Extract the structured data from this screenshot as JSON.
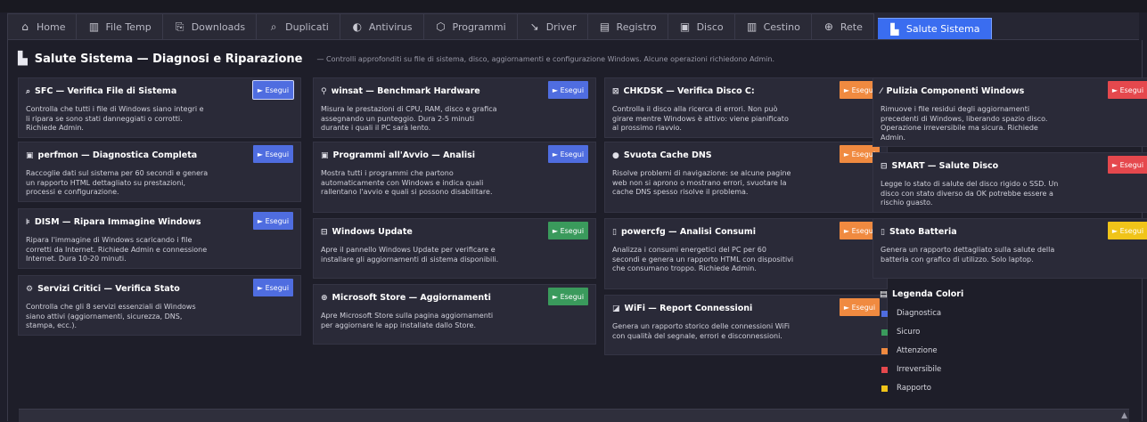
{
  "tabs": [
    {
      "icon": "⌂",
      "label": "Home"
    },
    {
      "icon": "▥",
      "label": "File Temp"
    },
    {
      "icon": "⎘",
      "label": "Downloads"
    },
    {
      "icon": "⌕",
      "label": "Duplicati"
    },
    {
      "icon": "◐",
      "label": "Antivirus"
    },
    {
      "icon": "⬡",
      "label": "Programmi"
    },
    {
      "icon": "↘",
      "label": "Driver"
    },
    {
      "icon": "▤",
      "label": "Registro"
    },
    {
      "icon": "▣",
      "label": "Disco"
    },
    {
      "icon": "▥",
      "label": "Cestino"
    },
    {
      "icon": "⊕",
      "label": "Rete"
    },
    {
      "icon": "▙",
      "label": "Salute Sistema"
    }
  ],
  "header": {
    "icon": "▙",
    "title": "Salute Sistema — Diagnosi e Riparazione",
    "subtitle": "— Controlli approfonditi su file di sistema, disco, aggiornamenti e configurazione Windows. Alcune operazioni richiedono Admin."
  },
  "columns": [
    [
      {
        "icon": "⌕",
        "title": "SFC — Verifica File di Sistema",
        "desc": "Controlla che tutti i file di Windows siano integri e li ripara se sono stati danneggiati o corrotti. Richiede Admin.",
        "button": "► Esegui",
        "color": "blue"
      },
      {
        "icon": "▣",
        "title": "perfmon — Diagnostica Completa",
        "desc": "Raccoglie dati sul sistema per 60 secondi e genera un rapporto HTML dettagliato su prestazioni, processi e configurazione.",
        "button": "► Esegui",
        "color": "blue"
      },
      {
        "icon": "⊧",
        "title": "DISM — Ripara Immagine Windows",
        "desc": "Ripara l'immagine di Windows scaricando i file corretti da Internet. Richiede Admin e connessione Internet. Dura 10-20 minuti.",
        "button": "► Esegui",
        "color": "blue"
      },
      {
        "icon": "⚙",
        "title": "Servizi Critici — Verifica Stato",
        "desc": "Controlla che gli 8 servizi essenziali di Windows siano attivi (aggiornamenti, sicurezza, DNS, stampa, ecc.).",
        "button": "► Esegui",
        "color": "blue"
      }
    ],
    [
      {
        "icon": "⚲",
        "title": "winsat — Benchmark Hardware",
        "desc": "Misura le prestazioni di CPU, RAM, disco e grafica assegnando un punteggio. Dura 2-5 minuti durante i quali il PC sarà lento.",
        "button": "► Esegui",
        "color": "blue"
      },
      {
        "icon": "▣",
        "title": "Programmi all'Avvio — Analisi",
        "desc": "Mostra tutti i programmi che partono automaticamente con Windows e indica quali rallentano l'avvio e quali si possono disabilitare.",
        "button": "► Esegui",
        "color": "blue"
      },
      {
        "icon": "⊟",
        "title": "Windows Update",
        "desc": "Apre il pannello Windows Update per verificare e installare gli aggiornamenti di sistema disponibili.",
        "button": "► Esegui",
        "color": "green"
      },
      {
        "icon": "⊕",
        "title": "Microsoft Store — Aggiornamenti",
        "desc": "Apre Microsoft Store sulla pagina aggiornamenti per aggiornare le app installate dallo Store.",
        "button": "► Esegui",
        "color": "green"
      }
    ],
    [
      {
        "icon": "⊠",
        "title": "CHKDSK — Verifica Disco C:",
        "desc": "Controlla il disco alla ricerca di errori. Non può girare mentre Windows è attivo: viene pianificato al prossimo riavvio.",
        "button": "► Esegui",
        "color": "orange"
      },
      {
        "icon": "●",
        "title": "Svuota Cache DNS",
        "desc": "Risolve problemi di navigazione: se alcune pagine web non si aprono o mostrano errori, svuotare la cache DNS spesso risolve il problema.",
        "button": "► Esegui",
        "color": "orange"
      },
      {
        "icon": "▯",
        "title": "powercfg — Analisi Consumi",
        "desc": "Analizza i consumi energetici del PC per 60 secondi e genera un rapporto HTML con dispositivi che consumano troppo. Richiede Admin.",
        "button": "► Esegui",
        "color": "orange"
      },
      {
        "icon": "◪",
        "title": "WiFi — Report Connessioni",
        "desc": "Genera un rapporto storico delle connessioni WiFi con qualità del segnale, errori e disconnessioni.",
        "button": "► Esegui",
        "color": "orange"
      }
    ],
    [
      {
        "icon": "⁄",
        "title": "Pulizia Componenti Windows",
        "desc": "Rimuove i file residui degli aggiornamenti precedenti di Windows, liberando spazio disco. Operazione irreversibile ma sicura. Richiede Admin.",
        "button": "► Esegui",
        "color": "red"
      },
      {
        "icon": "⊟",
        "title": "SMART — Salute Disco",
        "desc": "Legge lo stato di salute del disco rigido o SSD. Un disco con stato diverso da OK potrebbe essere a rischio guasto.",
        "button": "► Esegui",
        "color": "red"
      },
      {
        "icon": "▯",
        "title": "Stato Batteria",
        "desc": "Genera un rapporto dettagliato sulla salute della batteria con grafico di utilizzo. Solo laptop.",
        "button": "► Esegui",
        "color": "yellow"
      }
    ]
  ],
  "legend": {
    "icon": "▤",
    "title": "Legenda Colori",
    "items": [
      {
        "label": "Diagnostica",
        "color": "#4f6de0"
      },
      {
        "label": "Sicuro",
        "color": "#3a9a5c"
      },
      {
        "label": "Attenzione",
        "color": "#f08a40"
      },
      {
        "label": "Irreversibile",
        "color": "#e5484d"
      },
      {
        "label": "Rapporto",
        "color": "#f0c419"
      }
    ]
  }
}
